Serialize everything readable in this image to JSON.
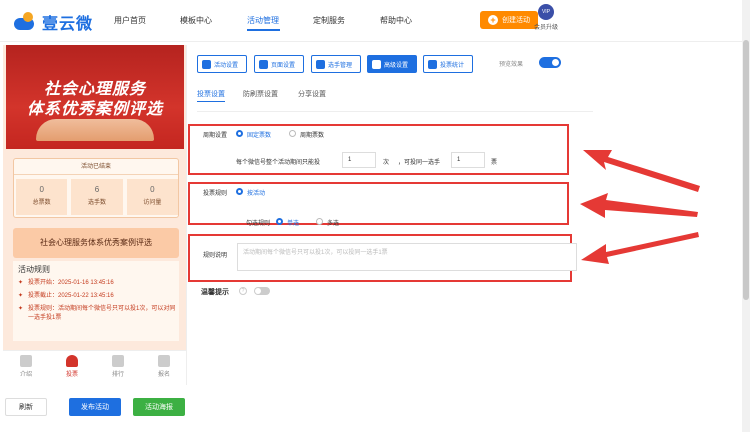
{
  "header": {
    "logo_text": "壹云微",
    "nav": [
      {
        "label": "用户首页"
      },
      {
        "label": "模板中心"
      },
      {
        "label": "活动管理"
      },
      {
        "label": "定制服务"
      },
      {
        "label": "帮助中心"
      }
    ],
    "create_label": "创建活动",
    "vip_badge": "VIP",
    "vip_label": "会员升级"
  },
  "preview": {
    "banner_line1": "社会心理服务",
    "banner_line2": "体系优秀案例评选",
    "status_text": "活动已结束",
    "stats": [
      {
        "value": "0",
        "label": "总票数"
      },
      {
        "value": "6",
        "label": "选手数"
      },
      {
        "value": "0",
        "label": "访问量"
      }
    ],
    "activity_title": "社会心理服务体系优秀案例评选",
    "rules_heading": "活动规则",
    "rules": [
      "投票开始：2025-01-16 13:45:16",
      "投票截止：2025-01-22 13:45:16",
      "投票规则：活动期间每个微信号只可以投1次，可以对同一选手投1票"
    ],
    "tabs": [
      {
        "label": "介绍"
      },
      {
        "label": "投票"
      },
      {
        "label": "排行"
      },
      {
        "label": "报名"
      }
    ]
  },
  "actions": {
    "refresh": "刷新",
    "publish": "发布活动",
    "poster": "活动海报"
  },
  "toolbar": {
    "buttons": [
      {
        "label": "活动设置"
      },
      {
        "label": "页面设置"
      },
      {
        "label": "选手管理"
      },
      {
        "label": "高级设置"
      },
      {
        "label": "投票统计"
      }
    ],
    "preview_label": "预览效果"
  },
  "subtabs": [
    {
      "label": "投票设置"
    },
    {
      "label": "防刷票设置"
    },
    {
      "label": "分享设置"
    }
  ],
  "settings": {
    "cycle_label": "周期设置",
    "cycle_fixed": "固定票数",
    "cycle_periodic": "周期票数",
    "cycle_desc": "每个微信号整个活动期间只能投",
    "cycle_value": "1",
    "cycle_unit": "次",
    "same_desc": "，可投同一选手",
    "same_value": "1",
    "same_unit": "票",
    "rule_label": "投票规则",
    "rule_option": "按活动",
    "check_label": "勾选规则",
    "single": "单选",
    "multi": "多选",
    "desc_label": "规则说明",
    "desc_placeholder": "活动期间每个微信号只可以投1次，可以投同一选手1票",
    "warn_label": "温馨提示",
    "help_icon": "?"
  }
}
